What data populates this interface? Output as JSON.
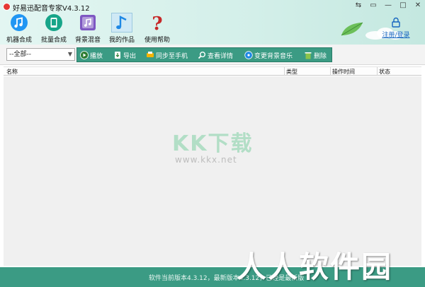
{
  "window": {
    "title": "好易迅配音专家V4.3.12",
    "controls": [
      "⇆",
      "▭",
      "—",
      "□",
      "✕"
    ]
  },
  "toolbar": {
    "tools": [
      {
        "label": "机器合成",
        "icon": "music-note-icon"
      },
      {
        "label": "批量合成",
        "icon": "batch-phone-icon"
      },
      {
        "label": "背景混音",
        "icon": "music-tile-icon"
      },
      {
        "label": "我的作品",
        "icon": "music-note-active-icon"
      },
      {
        "label": "使用帮助",
        "icon": "question-mark-icon"
      }
    ],
    "login_label": "注册/登录"
  },
  "filter": {
    "selected": "--全部--"
  },
  "actions": [
    {
      "label": "播放",
      "icon": "play-icon"
    },
    {
      "label": "导出",
      "icon": "export-icon"
    },
    {
      "label": "同步至手机",
      "icon": "sync-phone-icon"
    },
    {
      "label": "查看详情",
      "icon": "magnifier-icon"
    },
    {
      "label": "变更背景音乐",
      "icon": "disc-icon"
    },
    {
      "label": "删除",
      "icon": "trash-icon"
    }
  ],
  "table": {
    "columns": [
      "名称",
      "类型",
      "操作时间",
      "状态"
    ],
    "rows": []
  },
  "watermark": {
    "logo": "KK下载",
    "url": "www.kkx.net",
    "big": "人人软件园"
  },
  "status": {
    "text": "软件当前版本4.3.12，最新版本4.3.12，已经是最新版"
  },
  "colors": {
    "accent": "#3b9b84",
    "header_bg": "#d3efe9",
    "login_link": "#1565c0"
  }
}
